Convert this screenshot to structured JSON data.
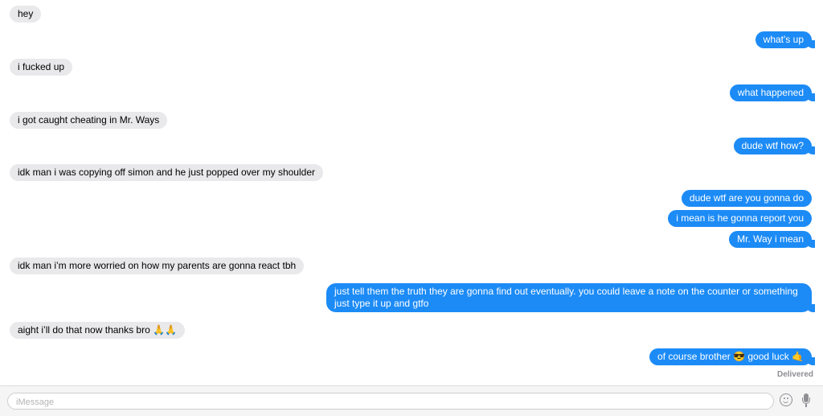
{
  "messages": [
    {
      "dir": "in",
      "text": "hey"
    },
    {
      "dir": "out",
      "text": "what's up"
    },
    {
      "dir": "in",
      "text": "i fucked up"
    },
    {
      "dir": "out",
      "text": "what happened"
    },
    {
      "dir": "in",
      "text": "i got caught cheating in Mr. Ways"
    },
    {
      "dir": "out",
      "text": "dude wtf how?"
    },
    {
      "dir": "in",
      "text": "idk man i was copying off simon and he just popped over my shoulder"
    },
    {
      "dir": "out",
      "text": "dude wtf are you gonna do"
    },
    {
      "dir": "out",
      "text": "i mean is he gonna report you"
    },
    {
      "dir": "out",
      "text": "Mr. Way i mean"
    },
    {
      "dir": "in",
      "text": "idk man i’m more worried on how my parents are gonna react tbh"
    },
    {
      "dir": "out",
      "text": "just tell them the truth they are gonna find out eventually. you could leave a note on the counter or something just type it up and gtfo"
    },
    {
      "dir": "in",
      "text": "aight i’ll do that now thanks bro 🙏🙏"
    },
    {
      "dir": "out",
      "text": "of course brother 😎 good luck 🤙"
    }
  ],
  "status": "Delivered",
  "composer": {
    "placeholder": "iMessage",
    "emoji_icon": "emoji-icon",
    "mic_icon": "microphone-icon"
  },
  "colors": {
    "outgoing": "#1c8bf6",
    "incoming": "#e9e9eb"
  }
}
